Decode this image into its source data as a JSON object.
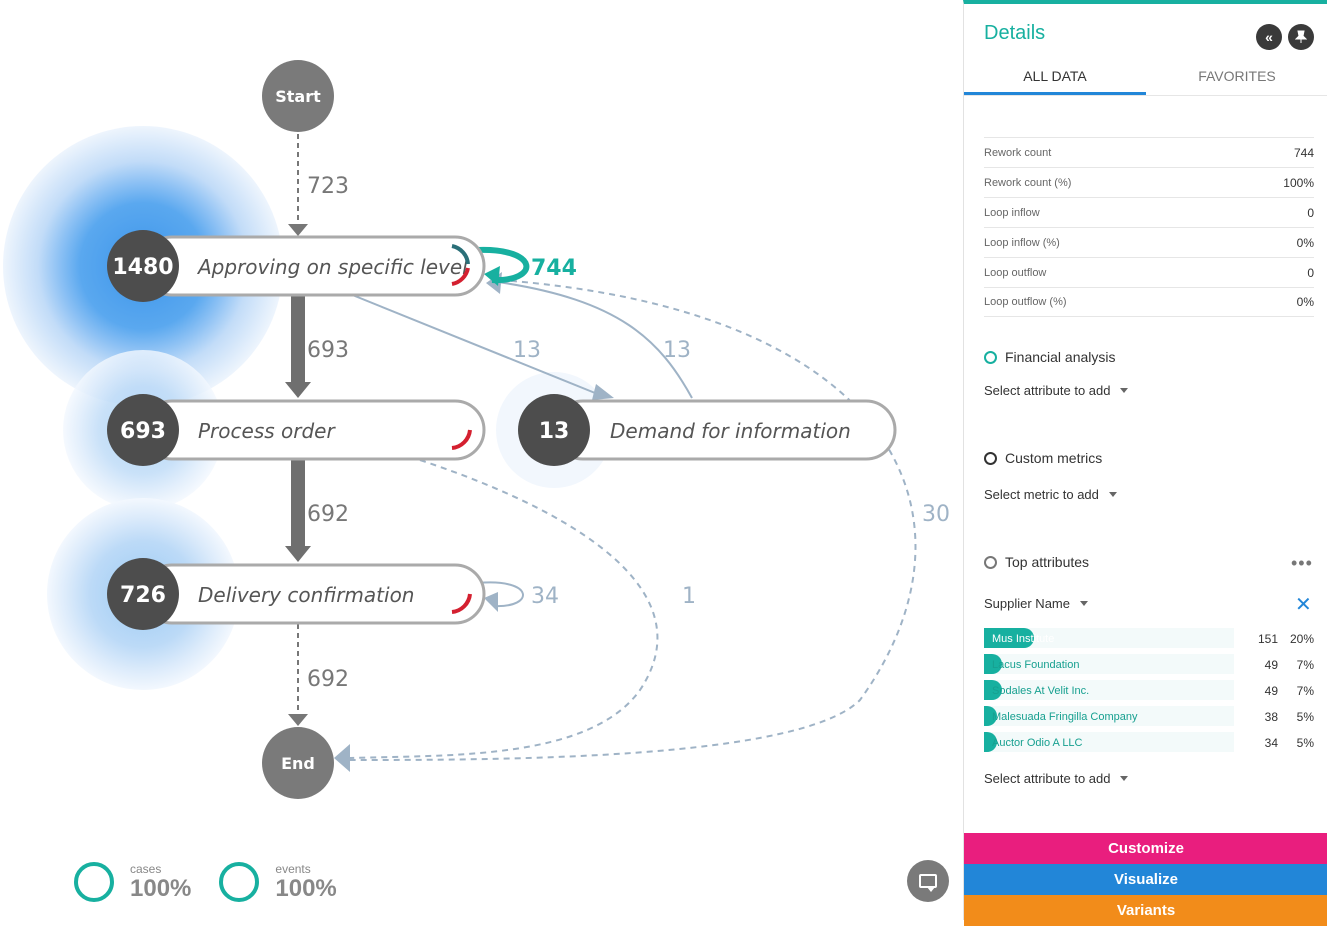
{
  "process_map": {
    "start_label": "Start",
    "end_label": "End",
    "activities": [
      {
        "name": "Approving on specific level",
        "count": "1480"
      },
      {
        "name": "Process order",
        "count": "693"
      },
      {
        "name": "Delivery confirmation",
        "count": "726"
      },
      {
        "name": "Demand for information",
        "count": "13"
      }
    ],
    "edges": {
      "start_to_approving": "723",
      "approving_loop": "744",
      "approving_to_process": "693",
      "approving_to_demand": "13",
      "demand_to_approving": "13",
      "process_to_delivery": "692",
      "delivery_loop": "34",
      "process_to_end": "1",
      "approving_to_end": "30",
      "delivery_to_end": "692"
    }
  },
  "stats": [
    {
      "label": "cases",
      "value": "100%"
    },
    {
      "label": "events",
      "value": "100%"
    }
  ],
  "details": {
    "title": "Details",
    "tabs": [
      {
        "label": "ALL DATA",
        "active": true
      },
      {
        "label": "FAVORITES",
        "active": false
      }
    ],
    "metrics": [
      {
        "label": "Rework count",
        "value": "744"
      },
      {
        "label": "Rework count (%)",
        "value": "100%"
      },
      {
        "label": "Loop inflow",
        "value": "0"
      },
      {
        "label": "Loop inflow (%)",
        "value": "0%"
      },
      {
        "label": "Loop outflow",
        "value": "0"
      },
      {
        "label": "Loop outflow (%)",
        "value": "0%"
      }
    ],
    "financial": {
      "title": "Financial analysis",
      "select": "Select attribute to add"
    },
    "custom": {
      "title": "Custom metrics",
      "select": "Select metric to add"
    },
    "top_attributes": {
      "title": "Top attributes",
      "attribute": "Supplier Name",
      "items": [
        {
          "name": "Mus Institute",
          "count": "151",
          "pct": "20%",
          "fraction": 0.2
        },
        {
          "name": "Lacus Foundation",
          "count": "49",
          "pct": "7%",
          "fraction": 0.07
        },
        {
          "name": "Sodales At Velit Inc.",
          "count": "49",
          "pct": "7%",
          "fraction": 0.07
        },
        {
          "name": "Malesuada Fringilla Company",
          "count": "38",
          "pct": "5%",
          "fraction": 0.05
        },
        {
          "name": "Auctor Odio A LLC",
          "count": "34",
          "pct": "5%",
          "fraction": 0.05
        }
      ],
      "select": "Select attribute to add"
    },
    "actions": [
      {
        "label": "Customize",
        "color": "#e91e7e"
      },
      {
        "label": "Visualize",
        "color": "#2286d8"
      },
      {
        "label": "Variants",
        "color": "#f28c1a"
      }
    ]
  },
  "colors": {
    "accent": "#17b0a0",
    "node": "#4d4d4d",
    "terminal": "#7a7a7a",
    "blue": "#2286d8"
  },
  "icons": [
    "collapse-panel-icon",
    "pin-icon",
    "more-icon",
    "close-icon",
    "chat-icon"
  ]
}
